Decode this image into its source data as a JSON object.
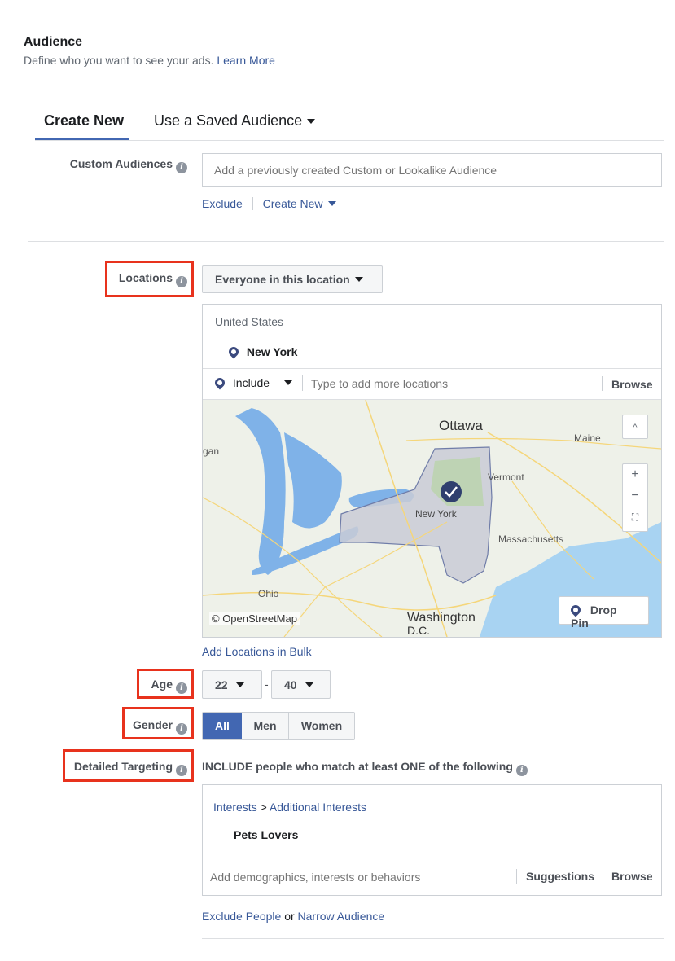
{
  "header": {
    "title": "Audience",
    "subtitle": "Define who you want to see your ads.",
    "learn_more": "Learn More"
  },
  "tabs": {
    "create_new": "Create New",
    "saved": "Use a Saved Audience"
  },
  "custom_audiences": {
    "label": "Custom Audiences",
    "placeholder": "Add a previously created Custom or Lookalike Audience",
    "exclude": "Exclude",
    "create_new": "Create New"
  },
  "locations": {
    "label": "Locations",
    "dropdown": "Everyone in this location",
    "country": "United States",
    "selected": "New York",
    "include": "Include",
    "placeholder": "Type to add more locations",
    "browse": "Browse",
    "add_bulk": "Add Locations in Bulk"
  },
  "map": {
    "ottawa": "Ottawa",
    "maine": "Maine",
    "gan": "gan",
    "vermont": "Vermont",
    "new_york": "New York",
    "massachusetts": "Massachusetts",
    "ohio": "Ohio",
    "washington": "Washington",
    "dc": "D.C.",
    "attribution": "© OpenStreetMap",
    "drop_pin": "Drop Pin",
    "zoom_in": "+",
    "zoom_out": "−",
    "up": "^"
  },
  "age": {
    "label": "Age",
    "min": "22",
    "sep": "-",
    "max": "40"
  },
  "gender": {
    "label": "Gender",
    "options": [
      "All",
      "Men",
      "Women"
    ]
  },
  "detailed": {
    "label": "Detailed Targeting",
    "include_text": "INCLUDE people who match at least ONE of the following",
    "crumb_a": "Interests",
    "crumb_sep": ">",
    "crumb_b": "Additional Interests",
    "item": "Pets Lovers",
    "placeholder": "Add demographics, interests or behaviors",
    "suggestions": "Suggestions",
    "browse": "Browse",
    "exclude": "Exclude People",
    "or": "or",
    "narrow": "Narrow Audience"
  },
  "colors": {
    "accent": "#4267b2",
    "link": "#385898",
    "highlight": "#e8321d"
  }
}
